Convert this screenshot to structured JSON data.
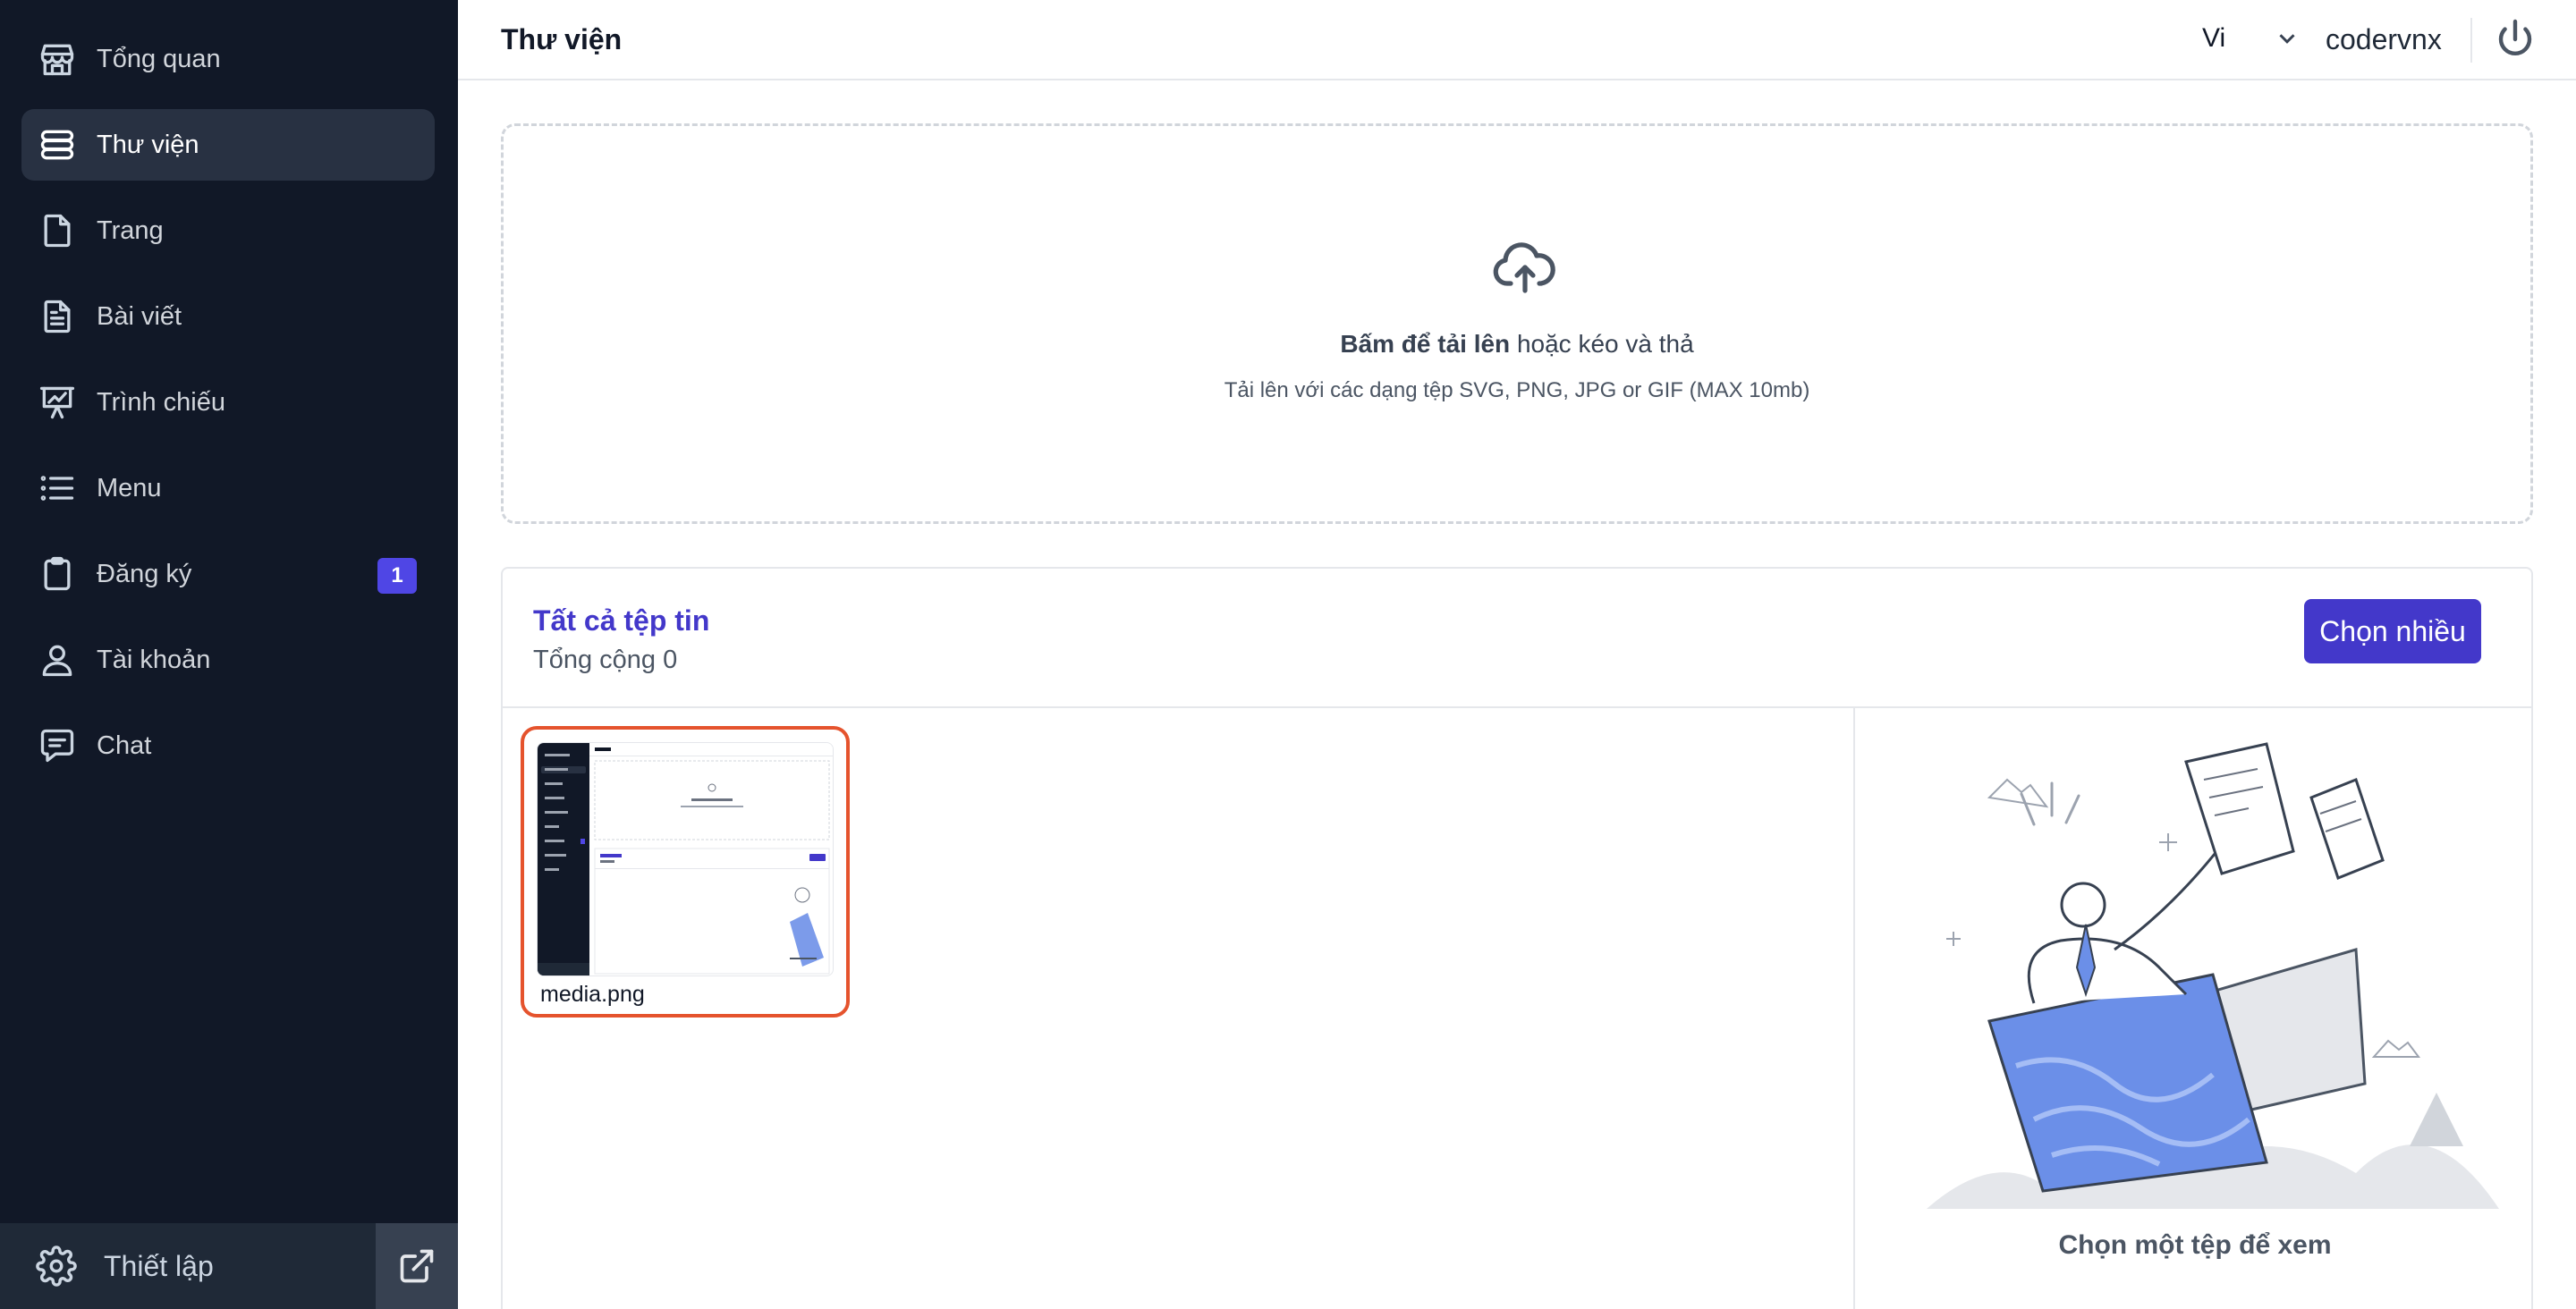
{
  "sidebar": {
    "items": [
      {
        "label": "Tổng quan",
        "icon": "store-icon"
      },
      {
        "label": "Thư viện",
        "icon": "stack-icon",
        "active": true
      },
      {
        "label": "Trang",
        "icon": "document-icon"
      },
      {
        "label": "Bài viết",
        "icon": "document-text-icon"
      },
      {
        "label": "Trình chiếu",
        "icon": "presentation-chart-icon"
      },
      {
        "label": "Menu",
        "icon": "list-icon"
      },
      {
        "label": "Đăng ký",
        "icon": "clipboard-icon",
        "badge": "1"
      },
      {
        "label": "Tài khoản",
        "icon": "user-icon"
      },
      {
        "label": "Chat",
        "icon": "chat-bubble-icon"
      }
    ],
    "footer": {
      "settings_label": "Thiết lập"
    }
  },
  "header": {
    "title": "Thư viện",
    "language": "Vi",
    "username": "codervnx"
  },
  "upload": {
    "action_bold": "Bấm để tải lên",
    "action_rest": " hoặc kéo và thả",
    "hint": "Tải lên với các dạng tệp SVG, PNG, JPG or GIF (MAX 10mb)"
  },
  "files": {
    "title": "Tất cả tệp tin",
    "count_label": "Tổng cộng 0",
    "select_multiple_label": "Chọn nhiều",
    "items": [
      {
        "name": "media.png",
        "selected": true
      }
    ],
    "preview_caption": "Chọn một tệp để xem"
  },
  "colors": {
    "sidebar_bg": "#111827",
    "accent": "#4338ca",
    "selected_border": "#e5532d",
    "badge": "#4f46e5"
  }
}
